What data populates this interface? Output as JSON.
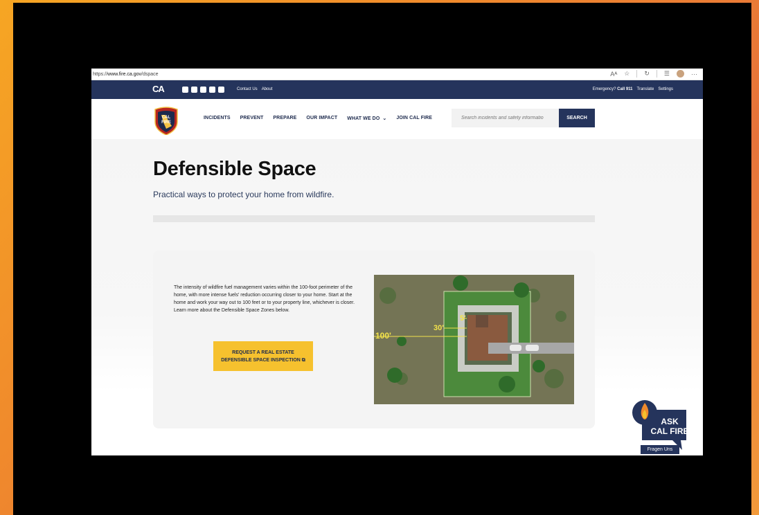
{
  "browser": {
    "url_prefix": "https://",
    "url_domain": "www.fire.ca.gov",
    "url_path": "/dspace",
    "toolbar_icons": [
      "read-aloud-icon",
      "favorite-star-icon",
      "refresh-icon",
      "favorites-list-icon",
      "profile-avatar-icon",
      "more-icon"
    ]
  },
  "utility_bar": {
    "ca_logo": "CA",
    "social_icons": [
      "instagram-icon",
      "facebook-icon",
      "youtube-icon",
      "flickr-icon",
      "x-icon"
    ],
    "contact": "Contact Us",
    "about": "About",
    "emergency_prefix": "Emergency?",
    "emergency_call": "Call 911",
    "translate": "Translate",
    "settings": "Settings"
  },
  "header": {
    "logo_text_top": "CAL",
    "logo_text_bottom": "FIRE",
    "nav": [
      "INCIDENTS",
      "PREVENT",
      "PREPARE",
      "OUR IMPACT",
      "WHAT WE DO",
      "JOIN CAL FIRE"
    ],
    "search_placeholder": "Search incidents and safety informatio",
    "search_button": "SEARCH"
  },
  "hero": {
    "title": "Defensible Space",
    "subtitle": "Practical ways to protect your home from wildfire."
  },
  "card": {
    "text": "The intensity of wildfire fuel management varies within the 100-foot perimeter of the home, with more intense fuels' reduction occurring closer to your home. Start at the home and work your way out to 100 feet or to your property line, whichever is closer. Learn more about the Defensible Space Zones below.",
    "cta_line1": "REQUEST A REAL ESTATE",
    "cta_line2": "DEFENSIBLE SPACE INSPECTION",
    "diagram_labels": {
      "d5": "5'",
      "d30": "30'",
      "d100": "100'"
    }
  },
  "ask_widget": {
    "line1": "ASK",
    "line2": "CAL FIRE",
    "fragen": "Fragen Uns"
  },
  "colors": {
    "navy": "#25345c",
    "yellow": "#f6c12e"
  }
}
